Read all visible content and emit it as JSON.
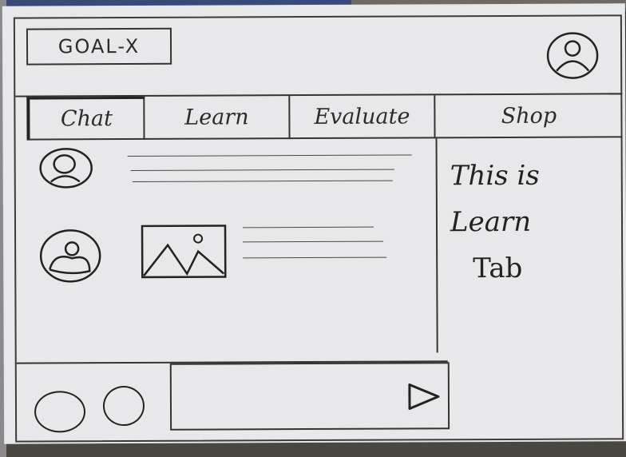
{
  "header": {
    "logo": "GOAL-X",
    "profile_icon": "user-profile-icon"
  },
  "tabs": [
    {
      "label": "Chat",
      "active": true
    },
    {
      "label": "Learn",
      "active": false
    },
    {
      "label": "Evaluate",
      "active": false
    },
    {
      "label": "Shop",
      "active": false
    }
  ],
  "side_note": {
    "line1": "This is",
    "line2": "Learn",
    "line3": "Tab"
  },
  "chat": {
    "messages": [
      {
        "avatar": "user-avatar-icon",
        "content": "text-lines"
      },
      {
        "avatar": "user-avatar-icon",
        "content": "image-and-text",
        "image_icon": "image-placeholder-icon"
      }
    ]
  },
  "composer": {
    "input_value": "",
    "send_icon": "send-icon"
  },
  "colors": {
    "paper": "#e8e8ea",
    "ink": "#2b2b2b"
  }
}
